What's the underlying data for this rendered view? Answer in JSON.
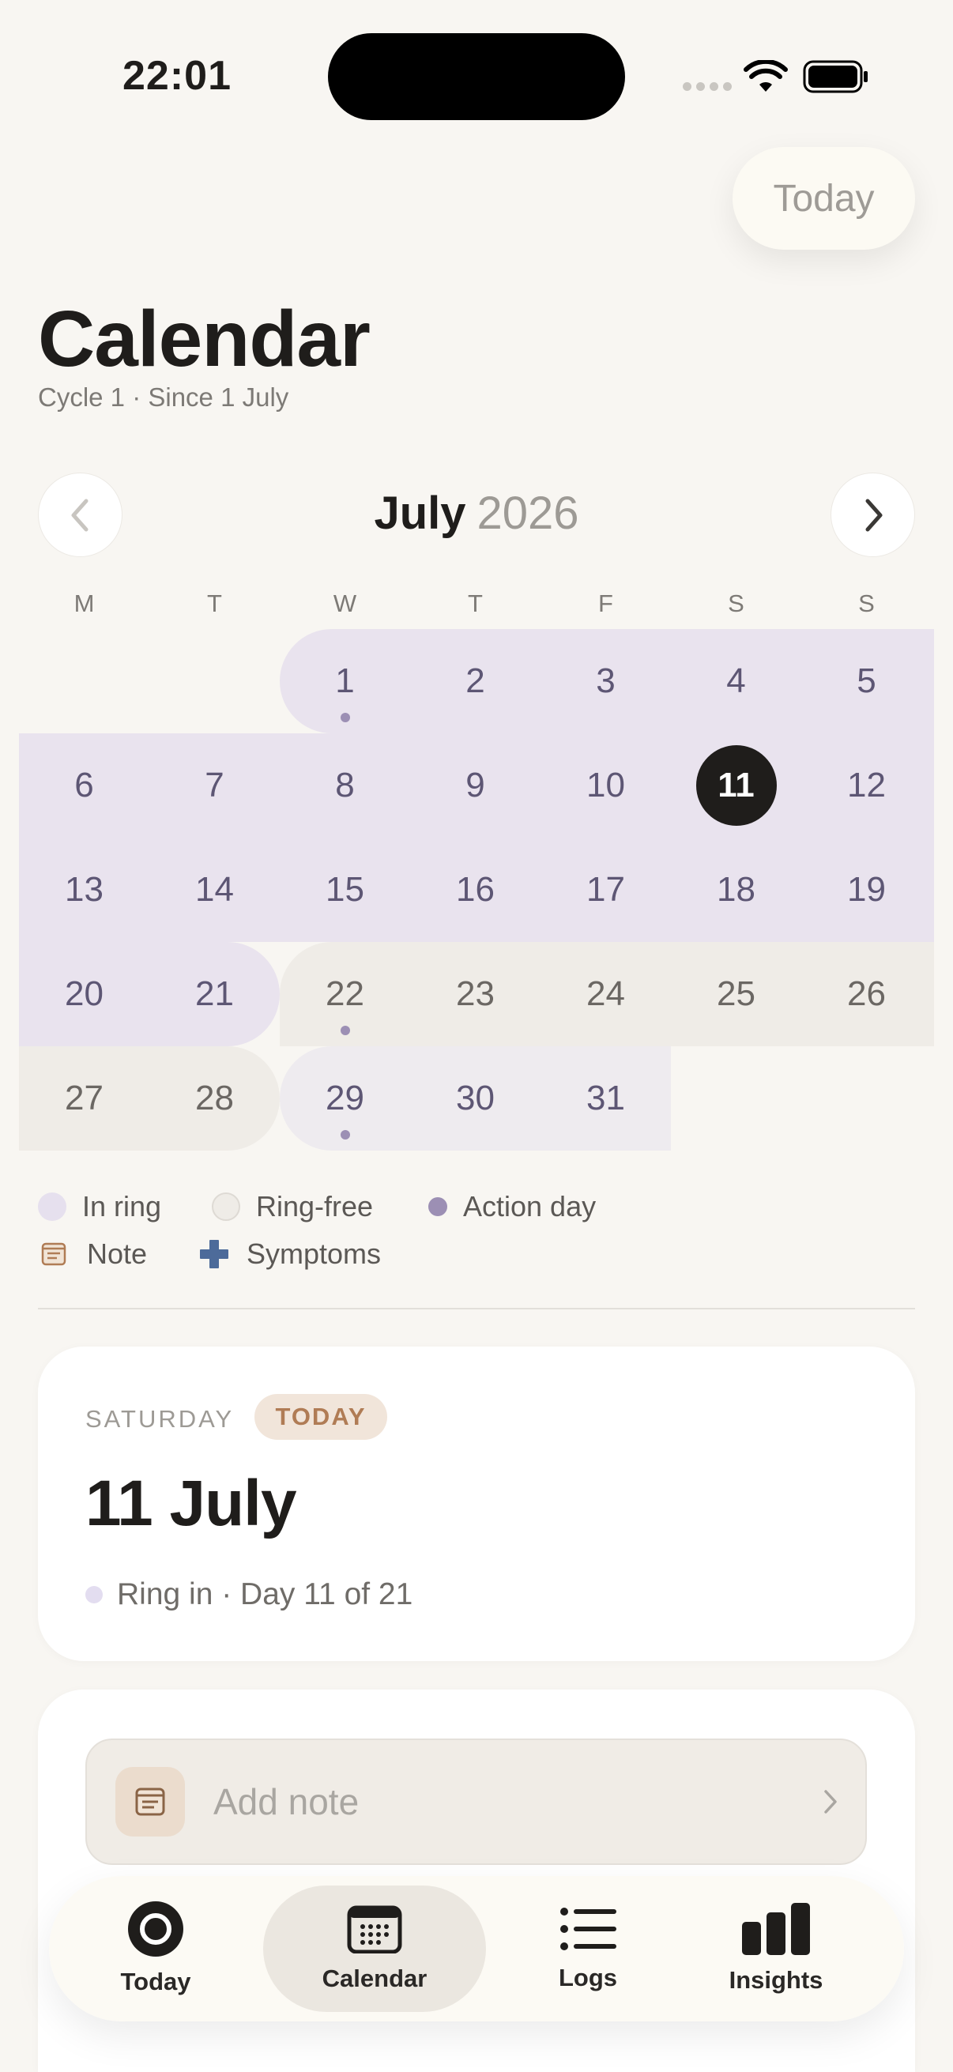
{
  "status_bar": {
    "time": "22:01"
  },
  "header": {
    "today_button": "Today",
    "title": "Calendar",
    "subtitle": "Cycle 1 · Since 1 July"
  },
  "month_nav": {
    "month": "July",
    "year": "2026"
  },
  "weekdays": [
    "M",
    "T",
    "W",
    "T",
    "F",
    "S",
    "S"
  ],
  "calendar": {
    "days": [
      "1",
      "2",
      "3",
      "4",
      "5",
      "6",
      "7",
      "8",
      "9",
      "10",
      "11",
      "12",
      "13",
      "14",
      "15",
      "16",
      "17",
      "18",
      "19",
      "20",
      "21",
      "22",
      "23",
      "24",
      "25",
      "26",
      "27",
      "28",
      "29",
      "30",
      "31"
    ],
    "selected_day": "11",
    "action_days": [
      "1",
      "22",
      "29"
    ]
  },
  "legend": {
    "in_ring": "In ring",
    "ring_free": "Ring-free",
    "action_day": "Action day",
    "note": "Note",
    "symptoms": "Symptoms"
  },
  "day_card": {
    "weekday": "SATURDAY",
    "badge": "TODAY",
    "date": "11 July",
    "status": "Ring in · Day 11 of 21"
  },
  "note_card": {
    "placeholder": "Add note"
  },
  "tabbar": {
    "items": [
      {
        "label": "Today",
        "icon": "ring-icon"
      },
      {
        "label": "Calendar",
        "icon": "calendar-icon",
        "active": true
      },
      {
        "label": "Logs",
        "icon": "list-icon"
      },
      {
        "label": "Insights",
        "icon": "bar-chart-icon"
      }
    ]
  },
  "colors": {
    "background": "#f8f6f2",
    "in_ring": "#e9e3ee",
    "ring_free": "#efece7",
    "action_dot": "#9c8fb4",
    "selected": "#1f1d1b",
    "today_badge": "#b07c55",
    "symptoms": "#4d6b9a"
  }
}
